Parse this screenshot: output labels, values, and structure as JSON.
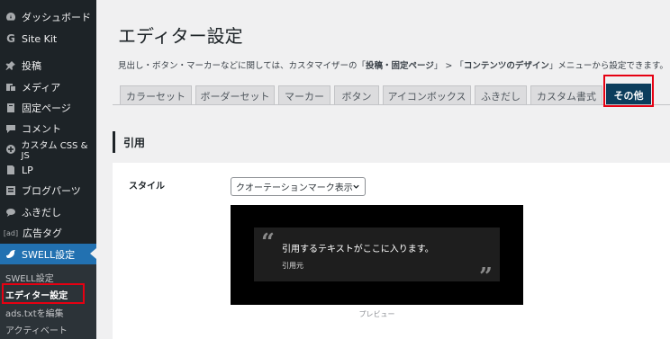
{
  "sidebar": {
    "items": [
      {
        "label": "ダッシュボード",
        "icon": "dashboard-icon"
      },
      {
        "label": "Site Kit",
        "icon": "google-g-icon"
      },
      {
        "label": "投稿",
        "icon": "pin-icon"
      },
      {
        "label": "メディア",
        "icon": "media-icon"
      },
      {
        "label": "固定ページ",
        "icon": "page-icon"
      },
      {
        "label": "コメント",
        "icon": "comment-icon"
      },
      {
        "label": "カスタム CSS & JS",
        "icon": "plus-circle-icon"
      },
      {
        "label": "LP",
        "icon": "lp-page-icon"
      },
      {
        "label": "ブログパーツ",
        "icon": "blog-parts-icon"
      },
      {
        "label": "ふきだし",
        "icon": "speech-bubble-icon"
      },
      {
        "label": "広告タグ",
        "icon": "ad-icon"
      },
      {
        "label": "SWELL設定",
        "icon": "swell-bird-icon"
      }
    ],
    "ad_icon_text": "[ad]",
    "submenu": [
      {
        "label": "SWELL設定"
      },
      {
        "label": "エディター設定"
      },
      {
        "label": "ads.txtを編集"
      },
      {
        "label": "アクティベート"
      }
    ]
  },
  "main": {
    "title": "エディター設定",
    "description_pre": "見出し・ボタン・マーカーなどに関しては、カスタマイザーの「",
    "description_bold1": "投稿・固定ページ",
    "description_mid": "」 > 「",
    "description_bold2": "コンテンツのデザイン",
    "description_post": "」メニューから設定できます。",
    "tabs": [
      {
        "label": "カラーセット"
      },
      {
        "label": "ボーダーセット"
      },
      {
        "label": "マーカー"
      },
      {
        "label": "ボタン"
      },
      {
        "label": "アイコンボックス"
      },
      {
        "label": "ふきだし"
      },
      {
        "label": "カスタム書式"
      },
      {
        "label": "その他"
      }
    ],
    "section_title": "引用",
    "style_label": "スタイル",
    "style_select_value": "クオーテーションマーク表示",
    "preview": {
      "open_mark": "“",
      "close_mark": "”",
      "quote_text": "引用するテキストがここに入ります。",
      "cite": "引用元",
      "caption": "プレビュー"
    }
  },
  "colors": {
    "sidebar_bg": "#1d2327",
    "sidebar_current": "#2271b1",
    "active_tab": "#0b3d5c",
    "highlight": "#e60012"
  }
}
